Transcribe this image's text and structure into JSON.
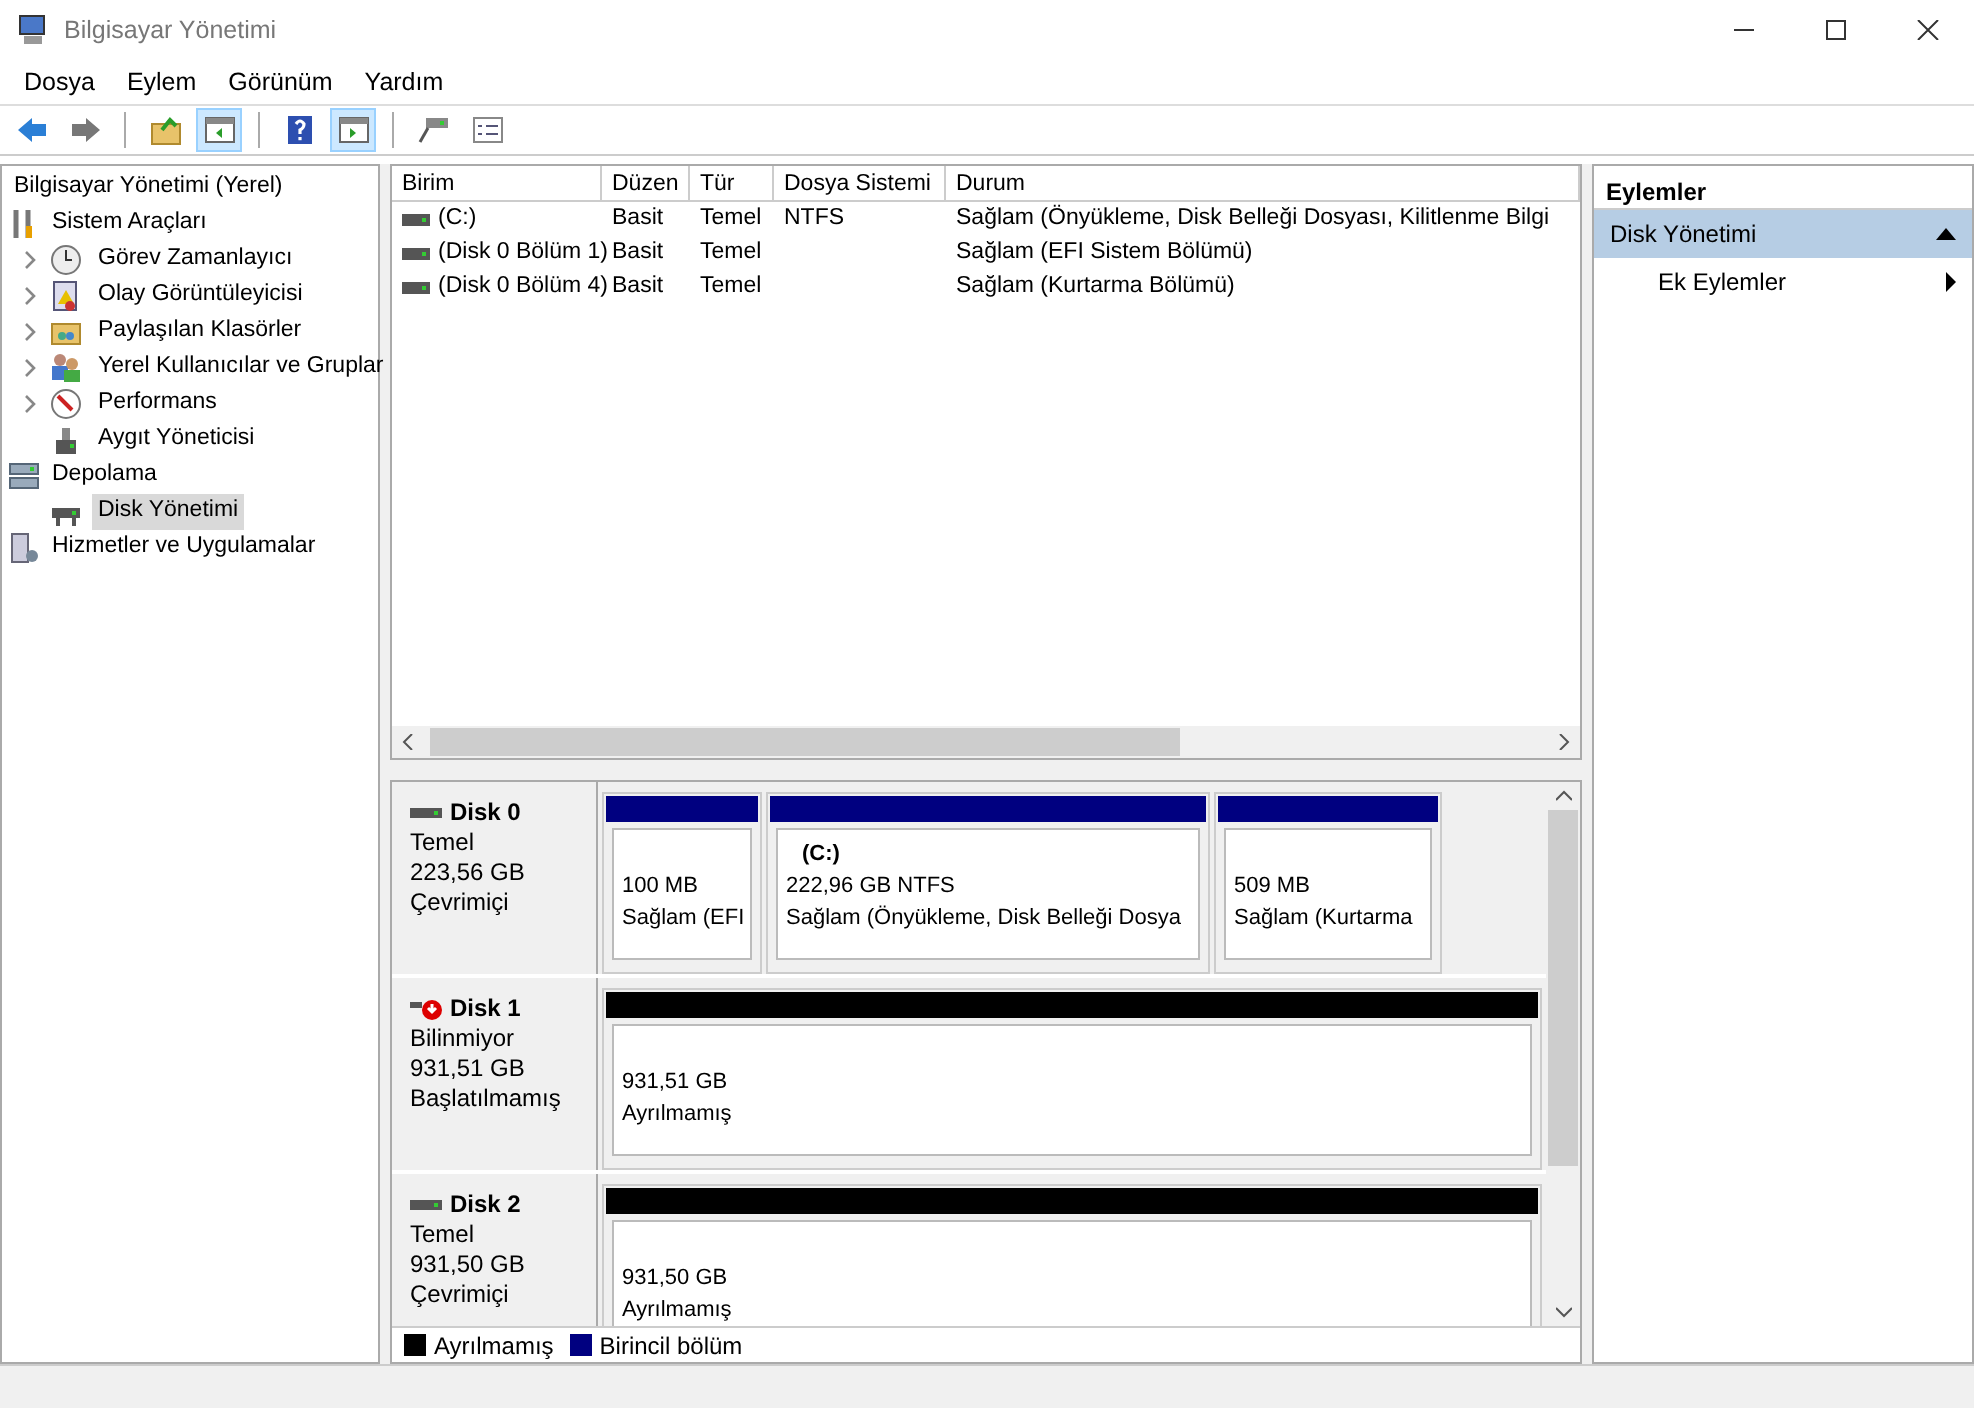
{
  "window": {
    "title": "Bilgisayar Yönetimi"
  },
  "menu": [
    "Dosya",
    "Eylem",
    "Görünüm",
    "Yardım"
  ],
  "toolbar": [
    {
      "kind": "back",
      "pressed": false
    },
    {
      "kind": "forward",
      "pressed": false
    },
    {
      "kind": "sep"
    },
    {
      "kind": "up",
      "pressed": false
    },
    {
      "kind": "tree",
      "pressed": true
    },
    {
      "kind": "sep"
    },
    {
      "kind": "help",
      "pressed": false
    },
    {
      "kind": "panel",
      "pressed": true
    },
    {
      "kind": "sep"
    },
    {
      "kind": "connect",
      "pressed": false
    },
    {
      "kind": "list",
      "pressed": false
    }
  ],
  "tree": {
    "label": "Bilgisayar Yönetimi (Yerel)",
    "selected": false,
    "children": [
      {
        "label": "Sistem Araçları",
        "selected": false,
        "children": [
          {
            "label": "Görev Zamanlayıcı",
            "expandable": true,
            "selected": false
          },
          {
            "label": "Olay Görüntüleyicisi",
            "expandable": true,
            "selected": false
          },
          {
            "label": "Paylaşılan Klasörler",
            "expandable": true,
            "selected": false
          },
          {
            "label": "Yerel Kullanıcılar ve Gruplar",
            "expandable": true,
            "selected": false
          },
          {
            "label": "Performans",
            "expandable": true,
            "selected": false
          },
          {
            "label": "Aygıt Yöneticisi",
            "expandable": false,
            "selected": false
          }
        ]
      },
      {
        "label": "Depolama",
        "selected": false,
        "children": [
          {
            "label": "Disk Yönetimi",
            "expandable": false,
            "selected": true
          }
        ]
      },
      {
        "label": "Hizmetler ve Uygulamalar",
        "selected": false
      }
    ]
  },
  "volumes": {
    "columns": [
      "Birim",
      "Düzen",
      "Tür",
      "Dosya Sistemi",
      "Durum"
    ],
    "rows": [
      [
        "(C:)",
        "Basit",
        "Temel",
        "NTFS",
        "Sağlam (Önyükleme, Disk Belleği Dosyası, Kilitlenme Bilgi"
      ],
      [
        "(Disk 0 Bölüm 1)",
        "Basit",
        "Temel",
        "",
        "Sağlam (EFI Sistem Bölümü)"
      ],
      [
        "(Disk 0 Bölüm 4)",
        "Basit",
        "Temel",
        "",
        "Sağlam (Kurtarma Bölümü)"
      ]
    ]
  },
  "disks": [
    {
      "name": "Disk 0",
      "error": false,
      "lines": [
        "Temel",
        "223,56 GB",
        "Çevrimiçi"
      ],
      "partitions": [
        {
          "kind": "primary",
          "size": "100 MB",
          "status": "Sağlam (EFI"
        },
        {
          "kind": "primary",
          "title": "(C:)",
          "size": "222,96 GB NTFS",
          "status": "Sağlam (Önyükleme, Disk Belleği Dosya"
        },
        {
          "kind": "primary",
          "size": "509 MB",
          "status": "Sağlam (Kurtarma"
        }
      ]
    },
    {
      "name": "Disk 1",
      "error": true,
      "lines": [
        "Bilinmiyor",
        "931,51 GB",
        "Başlatılmamış"
      ],
      "partitions": [
        {
          "kind": "unallocated",
          "size": "931,51 GB",
          "status": "Ayrılmamış"
        }
      ]
    },
    {
      "name": "Disk 2",
      "error": false,
      "lines": [
        "Temel",
        "931,50 GB",
        "Çevrimiçi"
      ],
      "partitions": [
        {
          "kind": "unallocated",
          "size": "931,50 GB",
          "status": "Ayrılmamış"
        }
      ]
    }
  ],
  "legend": [
    {
      "label": "Ayrılmamış",
      "color": "#000000"
    },
    {
      "label": "Birincil bölüm",
      "color": "#000080"
    }
  ],
  "actions": {
    "title": "Eylemler",
    "sections": [
      {
        "label": "Disk Yönetimi",
        "expanded": true,
        "items": [
          {
            "label": "Ek Eylemler"
          }
        ]
      }
    ]
  }
}
